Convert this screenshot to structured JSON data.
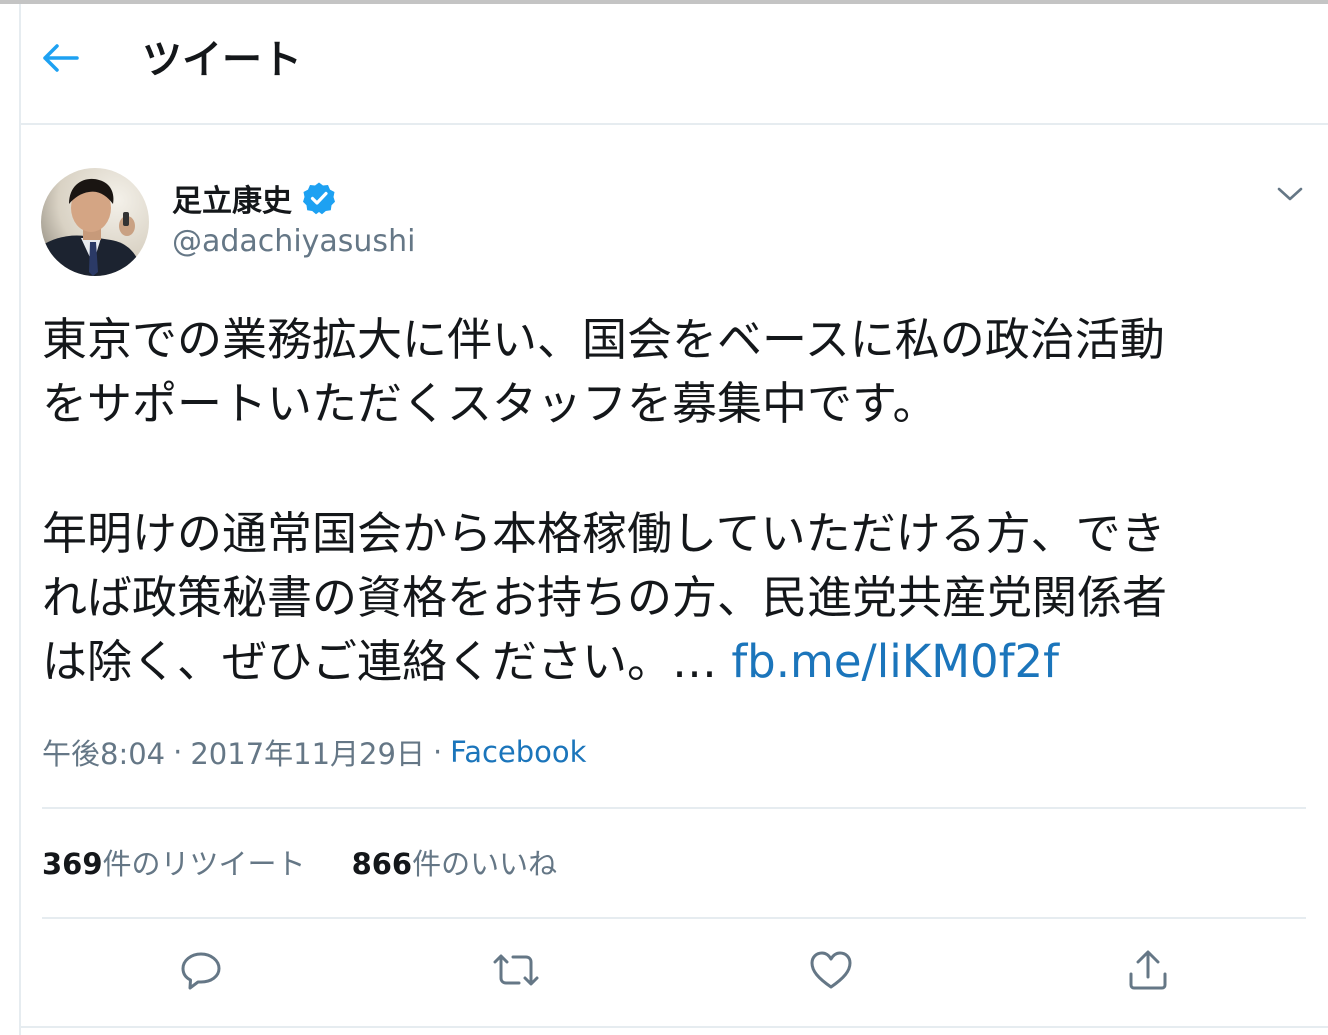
{
  "header": {
    "title": "ツイート",
    "back_icon": "arrow-left-icon",
    "accent_color": "#1da1f2"
  },
  "author": {
    "name": "足立康史",
    "handle": "@adachiyasushi",
    "verified": true,
    "verified_icon": "verified-badge-icon",
    "menu_icon": "chevron-down-icon"
  },
  "tweet": {
    "lines": [
      "東京での業務拡大に伴い、国会をベースに私の政治活動",
      "をサポートいただくスタッフを募集中です。",
      "年明けの通常国会から本格稼働していただける方、でき",
      "れば政策秘書の資格をお持ちの方、民進党共産党関係者",
      "は除く、ぜひご連絡ください。…"
    ],
    "link_text": "fb.me/liKM0f2f",
    "link_color": "#1b75bb"
  },
  "meta": {
    "time": "午後8:04",
    "separator": "·",
    "date": "2017年11月29日",
    "source": "Facebook"
  },
  "stats": {
    "retweets_count": "369",
    "retweets_label": "件のリツイート",
    "likes_count": "866",
    "likes_label": "件のいいね"
  },
  "actions": {
    "reply_icon": "reply-icon",
    "retweet_icon": "retweet-icon",
    "like_icon": "heart-icon",
    "share_icon": "share-icon",
    "icon_color": "#657786"
  }
}
